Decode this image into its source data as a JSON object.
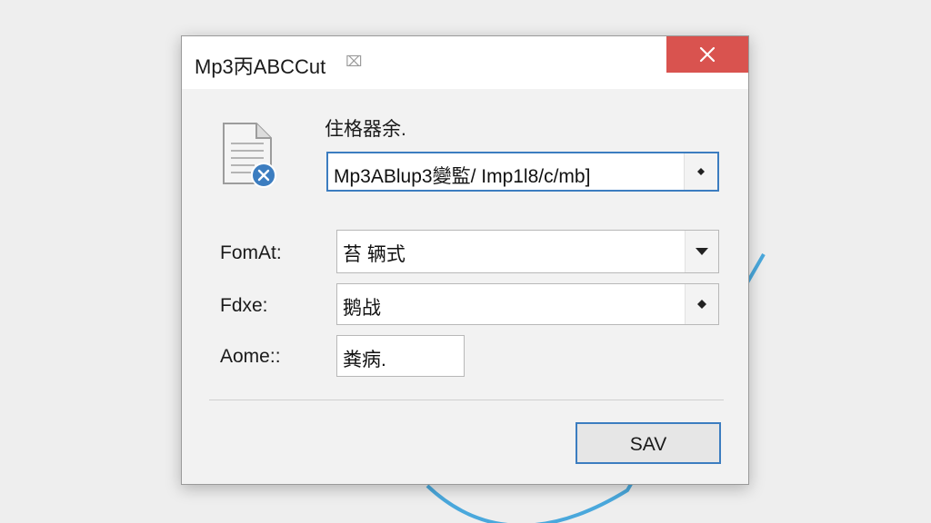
{
  "window": {
    "title": "Mp3丙ABCCut",
    "title_mark": "⌧",
    "close_icon": "close-icon"
  },
  "path": {
    "label": "住格器余.",
    "value": "Mp3ABlup3變監/ Imp1l8/c/mb]"
  },
  "form": {
    "format": {
      "label": "FomAt:",
      "value": "苔 辆式"
    },
    "fdxe": {
      "label": "Fdxe:",
      "value": "鹅战"
    },
    "aome": {
      "label": "Aome::",
      "value": "粪病."
    }
  },
  "actions": {
    "save_label": "SAV"
  },
  "colors": {
    "close_button": "#d9534f",
    "focus_border": "#3c7dc0",
    "background_arc": "#4aa8dc",
    "file_badge": "#3c7dc0"
  }
}
